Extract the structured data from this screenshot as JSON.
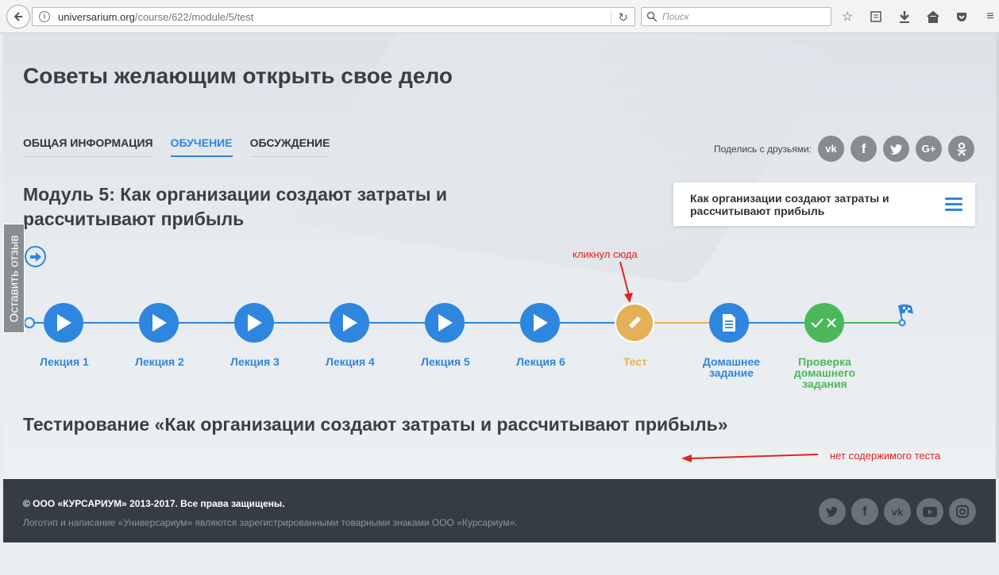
{
  "browser": {
    "url_host": "universarium.org",
    "url_path": "/course/622/module/5/test",
    "search_placeholder": "Поиск"
  },
  "course": {
    "title": "Советы желающим открыть свое дело"
  },
  "tabs": [
    {
      "label": "ОБЩАЯ ИНФОРМАЦИЯ"
    },
    {
      "label": "ОБУЧЕНИЕ"
    },
    {
      "label": "ОБСУЖДЕНИЕ"
    }
  ],
  "share": {
    "label": "Поделись с друзьями:",
    "networks": [
      "vk",
      "f",
      "twitter",
      "G+",
      "ok"
    ]
  },
  "module": {
    "title": "Модуль 5: Как организации создают затраты и рассчитывают прибыль",
    "card_title": "Как организации создают затраты и рассчитывают прибыль"
  },
  "timeline": {
    "nodes": [
      {
        "label": "Лекция 1"
      },
      {
        "label": "Лекция 2"
      },
      {
        "label": "Лекция 3"
      },
      {
        "label": "Лекция 4"
      },
      {
        "label": "Лекция 5"
      },
      {
        "label": "Лекция 6"
      },
      {
        "label": "Тест"
      },
      {
        "label": "Домашнее задание"
      },
      {
        "label": "Проверка домашнего задания"
      }
    ]
  },
  "annotations": {
    "clicked": "кликнул сюда",
    "no_content": "нет содержимого теста"
  },
  "test": {
    "title": "Тестирование «Как организации создают затраты и рассчитывают прибыль»"
  },
  "feedback": {
    "label": "Оставить отзыв"
  },
  "footer": {
    "copyright": "© ООО «КУРСАРИУМ» 2013-2017. Все права защищены.",
    "trademark": "Логотип и написание «Универсариум» являются зарегистрированными товарными знаками ООО «Курсариум»."
  },
  "colors": {
    "accent": "#2e86de",
    "test": "#e4b058",
    "check": "#4cb85c",
    "footer": "#353c44",
    "annotation": "#e0231f"
  }
}
